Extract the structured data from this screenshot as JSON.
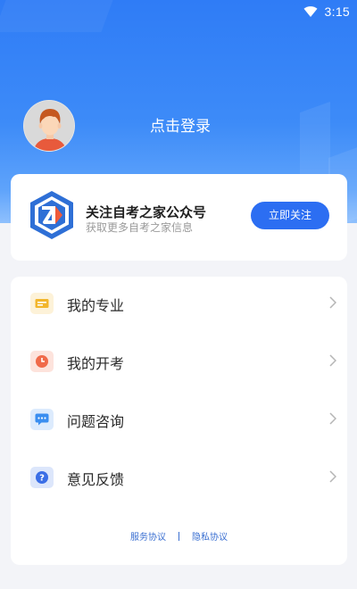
{
  "status": {
    "time": "3:15"
  },
  "header": {
    "login_label": "点击登录"
  },
  "follow_card": {
    "title": "关注自考之家公众号",
    "subtitle": "获取更多自考之家信息",
    "button_label": "立即关注"
  },
  "menu": {
    "items": [
      {
        "label": "我的专业",
        "icon": "briefcase-icon",
        "color": "#f2b62c",
        "bg": "#fdf2d8"
      },
      {
        "label": "我的开考",
        "icon": "clock-icon",
        "color": "#f06a4a",
        "bg": "#fde3dc"
      },
      {
        "label": "问题咨询",
        "icon": "chat-icon",
        "color": "#3a8ef0",
        "bg": "#dcebfd"
      },
      {
        "label": "意见反馈",
        "icon": "question-icon",
        "color": "#3a6ee6",
        "bg": "#dce6fb"
      }
    ]
  },
  "footer": {
    "service_label": "服务协议",
    "privacy_label": "隐私协议"
  },
  "colors": {
    "brand": "#2c6ef2",
    "header_top": "#2f7cf6"
  }
}
